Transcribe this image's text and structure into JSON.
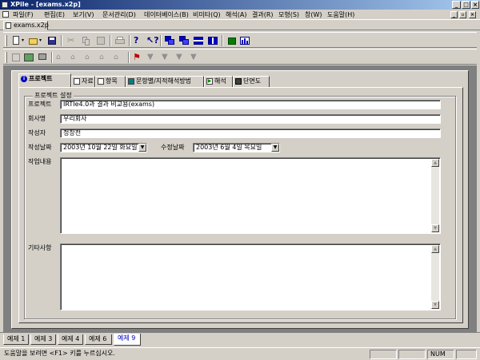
{
  "window": {
    "title": "XPile - [exams.x2p]"
  },
  "menu": {
    "items": [
      "파일(F)",
      "편집(E)",
      "보기(V)",
      "문서관리(D)",
      "데이터베이스(B)",
      "비미타(Q)",
      "해석(A)",
      "결과(R)",
      "모형(S)",
      "창(W)",
      "도움말(H)"
    ]
  },
  "document_tab": {
    "label": "exams.x2p"
  },
  "property_tabs": [
    "프로젝트",
    "자료",
    "항목",
    "문항별/지적해석방법",
    "해석",
    "단면도"
  ],
  "project": {
    "group_title": "프로젝트 설정",
    "labels": {
      "project": "프로젝트",
      "company": "회사명",
      "author": "작성자",
      "created": "작성날짜",
      "modified": "수정날짜",
      "content": "작업내용",
      "notes": "기타사항"
    },
    "values": {
      "project": "IRTIe4.0과 결과 비교용(exams)",
      "company": "우리회사",
      "author": "정창전",
      "created": "2003년 10월 22일 화요일",
      "modified": "2003년   6월   4일 목요일"
    }
  },
  "sheet_tabs": [
    "예제 1",
    "예제 3",
    "예제 4",
    "예제 6",
    "예제 9"
  ],
  "active_sheet_tab": "예제 9",
  "status": {
    "message": "도움말을 보려면 <F1> 키를 누르십시오.",
    "num": "NUM"
  },
  "icons": {
    "toolbar1": [
      "new-icon",
      "open-icon",
      "save-icon",
      "cut-icon",
      "copy-icon",
      "paste-icon",
      "print-icon",
      "help-icon",
      "context-help-icon",
      "window-icon",
      "window-icon",
      "window-icon",
      "window-icon",
      "chart-icon",
      "chart-icon"
    ],
    "toolbar2": [
      "tool-icon",
      "tool-icon",
      "tool-icon",
      "tool-icon",
      "tool-icon",
      "tool-icon",
      "tool-icon",
      "run-icon",
      "run-icon",
      "run-icon",
      "run-icon",
      "run-icon"
    ]
  }
}
